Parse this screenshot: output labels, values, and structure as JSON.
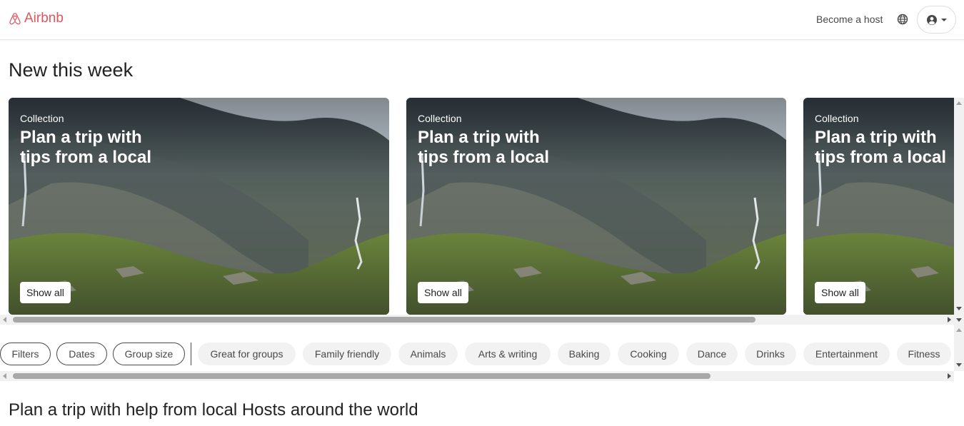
{
  "header": {
    "brand": "Airbnb",
    "become_host": "Become a host",
    "brand_color": "#e0565b",
    "icons": [
      "airbnb-logo-icon",
      "globe-icon",
      "user-circle-icon",
      "chevron-down-icon"
    ]
  },
  "section": {
    "title": "New this week"
  },
  "cards": [
    {
      "eyebrow": "Collection",
      "title": "Plan a trip with tips from a local",
      "button": "Show all"
    },
    {
      "eyebrow": "Collection",
      "title": "Plan a trip with tips from a local",
      "button": "Show all"
    },
    {
      "eyebrow": "Collection",
      "title": "Plan a trip with tips from a local",
      "button": "Show all"
    }
  ],
  "filters": {
    "primary": [
      "Filters",
      "Dates",
      "Group size"
    ],
    "categories": [
      "Great for groups",
      "Family friendly",
      "Animals",
      "Arts & writing",
      "Baking",
      "Cooking",
      "Dance",
      "Drinks",
      "Entertainment",
      "Fitness"
    ]
  },
  "bottom": {
    "title": "Plan a trip with help from local Hosts around the world"
  }
}
